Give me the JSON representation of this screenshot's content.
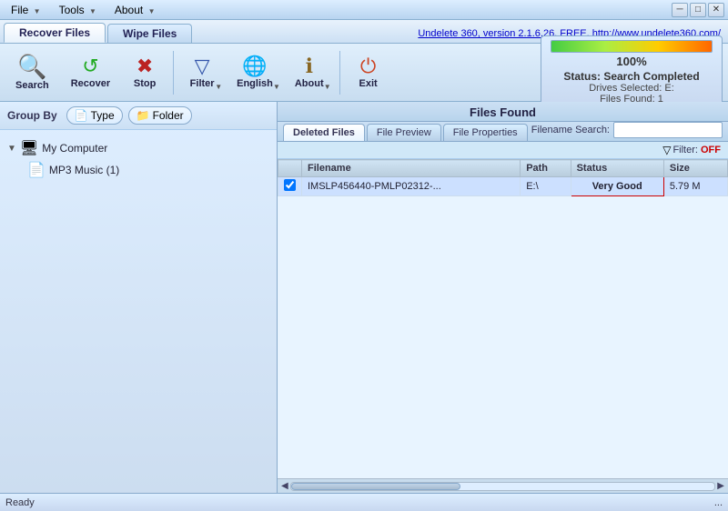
{
  "titlebar": {
    "menus": [
      {
        "label": "File",
        "id": "file"
      },
      {
        "label": "Tools",
        "id": "tools"
      },
      {
        "label": "About",
        "id": "about"
      }
    ],
    "controls": [
      "─",
      "□",
      "✕"
    ]
  },
  "tabs": {
    "items": [
      {
        "label": "Recover Files",
        "active": true
      },
      {
        "label": "Wipe Files",
        "active": false
      }
    ],
    "promo_link": "Undelete 360, version 2.1.6.26, FREE, http://www.undelete360.com/"
  },
  "toolbar": {
    "buttons": [
      {
        "id": "search",
        "icon": "🔍",
        "label": "Search"
      },
      {
        "id": "recover",
        "icon": "↩",
        "label": "Recover"
      },
      {
        "id": "stop",
        "icon": "✖",
        "label": "Stop"
      },
      {
        "id": "filter",
        "icon": "▼",
        "label": "Filter",
        "has_arrow": true
      },
      {
        "id": "language",
        "icon": "🌐",
        "label": "English",
        "has_arrow": true
      },
      {
        "id": "about",
        "icon": "ℹ",
        "label": "About",
        "has_arrow": true
      },
      {
        "id": "exit",
        "icon": "⏻",
        "label": "Exit"
      }
    ]
  },
  "status_panel": {
    "progress": 100,
    "progress_label": "100%",
    "status_line1": "Status: Search Completed",
    "status_line2": "Drives Selected: E:",
    "status_line3": "Files Found: 1"
  },
  "group_by": {
    "label": "Group By",
    "buttons": [
      {
        "icon": "📄",
        "label": "Type"
      },
      {
        "icon": "📁",
        "label": "Folder"
      }
    ]
  },
  "tree": {
    "root": {
      "icon": "🖥",
      "label": "My Computer",
      "expanded": true
    },
    "children": [
      {
        "icon": "📄",
        "label": "MP3 Music (1)"
      }
    ]
  },
  "right_panel": {
    "header": "Files Found",
    "tabs": [
      {
        "label": "Deleted Files",
        "active": true
      },
      {
        "label": "File Preview",
        "active": false
      },
      {
        "label": "File Properties",
        "active": false
      }
    ],
    "filename_search": {
      "label": "Filename Search:",
      "placeholder": ""
    },
    "filter_label": "🔽 Filter:",
    "filter_status": "OFF",
    "table": {
      "columns": [
        {
          "id": "check",
          "label": ""
        },
        {
          "id": "filename",
          "label": "Filename"
        },
        {
          "id": "path",
          "label": "Path"
        },
        {
          "id": "status",
          "label": "Status"
        },
        {
          "id": "size",
          "label": "Size"
        }
      ],
      "rows": [
        {
          "checked": true,
          "filename": "IMSLP456440-PMLP02312-...",
          "path": "E:\\",
          "status": "Very Good",
          "size": "5.79 M"
        }
      ]
    }
  },
  "status_bar": {
    "text": "Ready",
    "dots": "..."
  }
}
